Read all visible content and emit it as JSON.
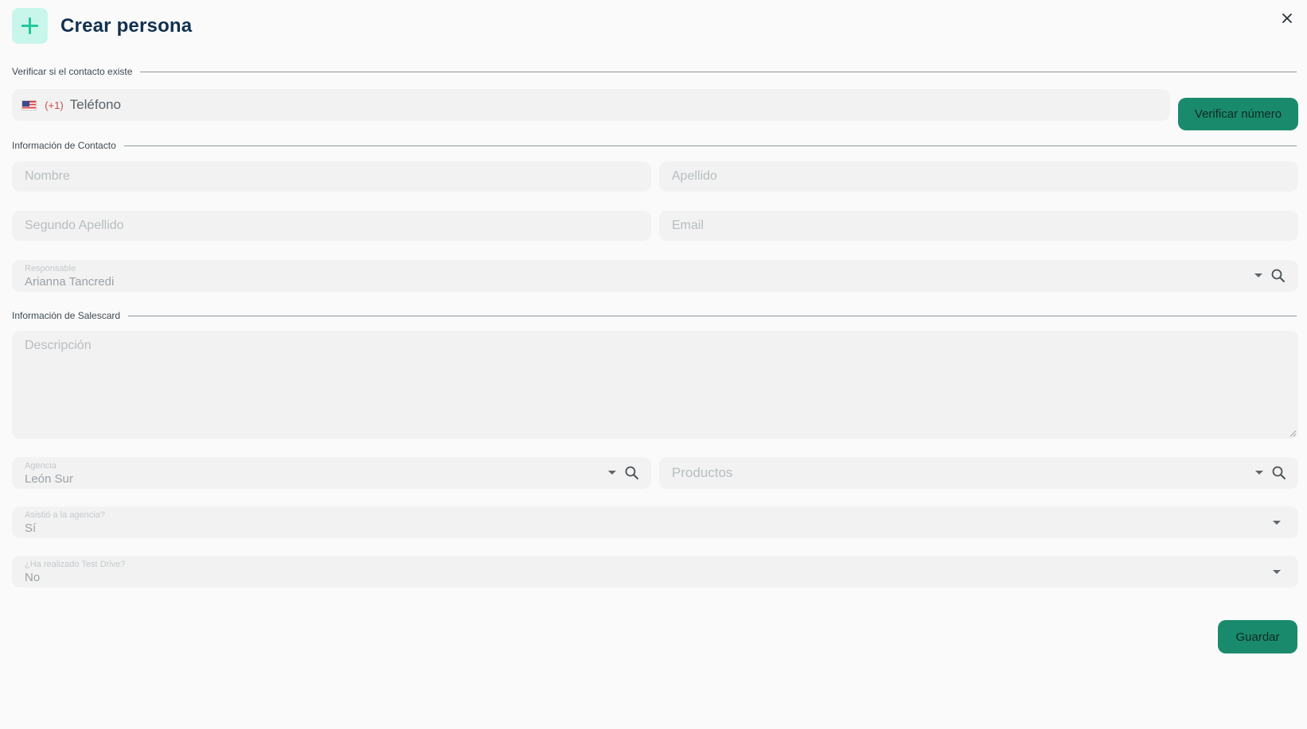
{
  "header": {
    "title": "Crear persona",
    "add_icon": "plus-icon",
    "close_icon": "close-icon"
  },
  "verify_section": {
    "label": "Verificar si el contacto existe",
    "phone": {
      "flag_icon": "us-flag-icon",
      "dial_code": "(+1)",
      "placeholder": "Teléfono",
      "value": ""
    },
    "verify_button": "Verificar número"
  },
  "contact_section": {
    "label": "Información de Contacto",
    "nombre_placeholder": "Nombre",
    "apellido_placeholder": "Apellido",
    "segundo_apellido_placeholder": "Segundo Apellido",
    "email_placeholder": "Email",
    "responsable": {
      "label": "Responsable",
      "value": "Arianna Tancredi"
    }
  },
  "salescard_section": {
    "label": "Información de Salescard",
    "descripcion_placeholder": "Descripción",
    "agencia": {
      "label": "Agencia",
      "value": "León Sur"
    },
    "productos_placeholder": "Productos",
    "asistio": {
      "label": "Asistió a la agencia?",
      "value": "Sí"
    },
    "test_drive": {
      "label": "¿Ha realizado Test Drive?",
      "value": "No"
    }
  },
  "footer": {
    "save_button": "Guardar"
  },
  "colors": {
    "primary": "#1a8a6d",
    "title": "#11304f",
    "icon_bg": "#c9f6ea",
    "icon_fg": "#23c79d"
  }
}
